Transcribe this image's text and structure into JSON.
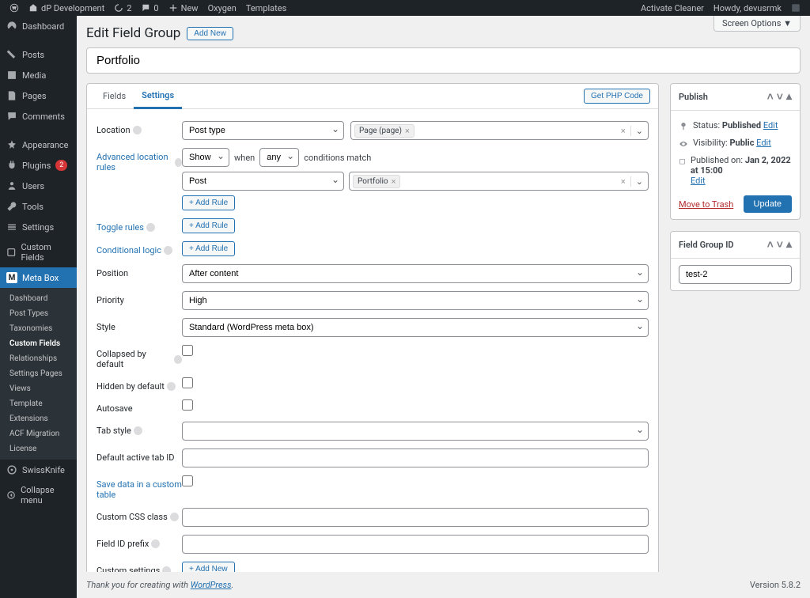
{
  "toolbar": {
    "site_name": "dP Development",
    "comments_count": "2",
    "updates_count": "0",
    "new_label": "New",
    "oxygen_label": "Oxygen",
    "templates_label": "Templates",
    "activate_cleaner": "Activate Cleaner",
    "howdy": "Howdy, devusrmk"
  },
  "sidebar": {
    "dashboard": "Dashboard",
    "posts": "Posts",
    "media": "Media",
    "pages": "Pages",
    "comments": "Comments",
    "appearance": "Appearance",
    "plugins": "Plugins",
    "plugins_badge": "2",
    "users": "Users",
    "tools": "Tools",
    "settings": "Settings",
    "custom_fields_top": "Custom Fields",
    "meta_box": "Meta Box",
    "sub": {
      "dashboard": "Dashboard",
      "post_types": "Post Types",
      "taxonomies": "Taxonomies",
      "custom_fields": "Custom Fields",
      "relationships": "Relationships",
      "settings_pages": "Settings Pages",
      "views": "Views",
      "template": "Template",
      "extensions": "Extensions",
      "acf_migration": "ACF Migration",
      "license": "License"
    },
    "swissknife": "SwissKnife",
    "collapse": "Collapse menu"
  },
  "screen_options": "Screen Options",
  "page": {
    "title": "Edit Field Group",
    "add_new": "Add New",
    "group_name": "Portfolio"
  },
  "tabs": {
    "fields": "Fields",
    "settings": "Settings",
    "get_php": "Get PHP Code"
  },
  "settings": {
    "location_label": "Location",
    "location_select": "Post type",
    "location_tag": "Page (page)",
    "adv_rules_label": "Advanced location rules",
    "adv_show": "Show",
    "adv_when": "when",
    "adv_any": "any",
    "adv_conditions_match": "conditions match",
    "adv_post": "Post",
    "adv_portfolio_tag": "Portfolio",
    "add_rule": "+ Add Rule",
    "toggle_rules": "Toggle rules",
    "conditional_logic": "Conditional logic",
    "position_label": "Position",
    "position_value": "After content",
    "priority_label": "Priority",
    "priority_value": "High",
    "style_label": "Style",
    "style_value": "Standard (WordPress meta box)",
    "collapsed_label": "Collapsed by default",
    "hidden_label": "Hidden by default",
    "autosave_label": "Autosave",
    "tabstyle_label": "Tab style",
    "default_tab_label": "Default active tab ID",
    "save_table_label": "Save data in a custom table",
    "css_class_label": "Custom CSS class",
    "prefix_label": "Field ID prefix",
    "custom_settings_label": "Custom settings",
    "add_new": "+ Add New"
  },
  "publish": {
    "header": "Publish",
    "status_label": "Status:",
    "status_value": "Published",
    "visibility_label": "Visibility:",
    "visibility_value": "Public",
    "published_on_label": "Published on:",
    "published_on_value": "Jan 2, 2022 at 15:00",
    "edit": "Edit",
    "trash": "Move to Trash",
    "update": "Update"
  },
  "group_id": {
    "header": "Field Group ID",
    "value": "test-2"
  },
  "footer": {
    "thanks_prefix": "Thank you for creating with ",
    "wp": "WordPress",
    "version": "Version 5.8.2"
  }
}
